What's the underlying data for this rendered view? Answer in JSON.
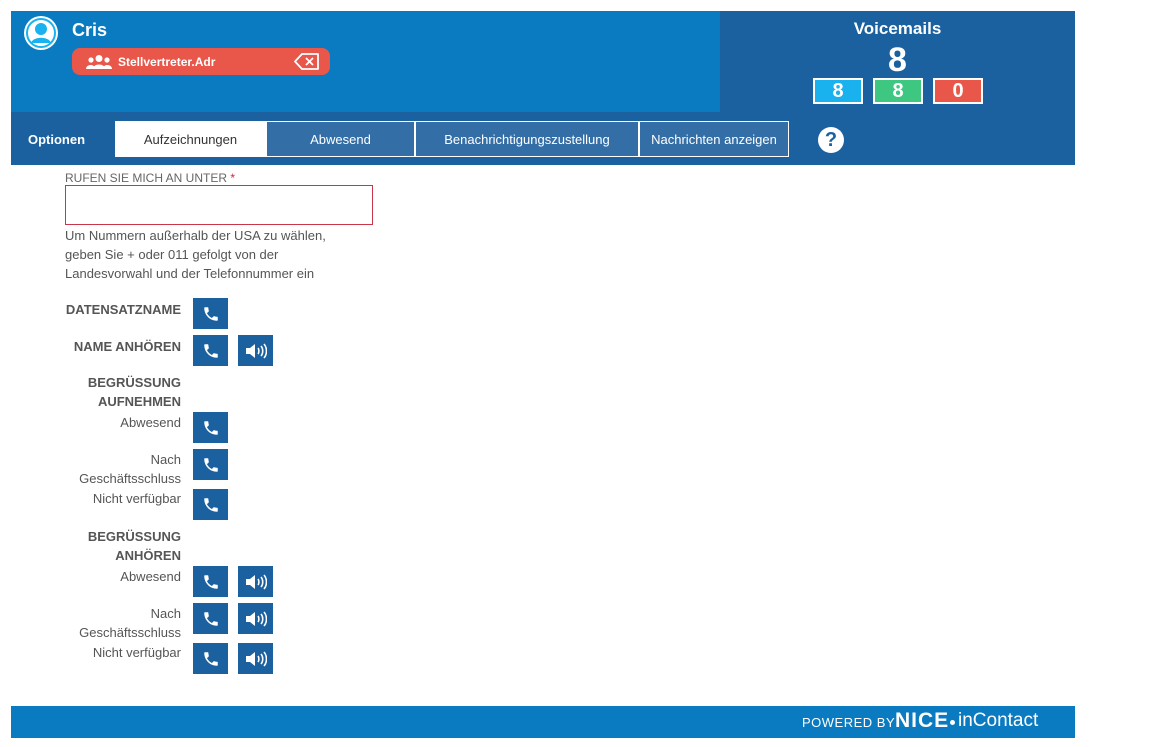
{
  "header": {
    "user_name": "Cris",
    "agent_label": "Stellvertreter.Adr",
    "voicemails": {
      "title": "Voicemails",
      "total": "8",
      "badge_blue": "8",
      "badge_green": "8",
      "badge_red": "0"
    }
  },
  "tabs": {
    "options_label": "Optionen",
    "items": [
      {
        "label": "Aufzeichnungen"
      },
      {
        "label": "Abwesend"
      },
      {
        "label": "Benachrichtigungszustellung"
      },
      {
        "label": "Nachrichten anzeigen"
      }
    ],
    "help": "?"
  },
  "form": {
    "callback_label": "RUFEN SIE MICH AN UNTER",
    "required_mark": "*",
    "callback_value": "",
    "hint": "Um Nummern außerhalb der USA zu wählen, geben Sie + oder 011 gefolgt von der Landesvorwahl und der Telefonnummer ein"
  },
  "recordings": {
    "record_name": "DATENSATZNAME",
    "listen_name": "NAME ANHÖREN",
    "record_greeting": "BEGRÜSSUNG AUFNEHMEN",
    "listen_greeting": "BEGRÜSSUNG ANHÖREN",
    "absent": "Abwesend",
    "after_hours": "Nach Geschäftsschluss",
    "unavailable": "Nicht verfügbar"
  },
  "footer": {
    "powered_by": "POWERED BY",
    "brand_nice": "NICE",
    "brand_incontact": "inContact"
  },
  "colors": {
    "header_blue": "#0a7bc1",
    "panel_blue": "#1b61a0",
    "accent_red": "#e8574a",
    "accent_green": "#3ec780",
    "accent_cyan": "#1ab1ef"
  }
}
